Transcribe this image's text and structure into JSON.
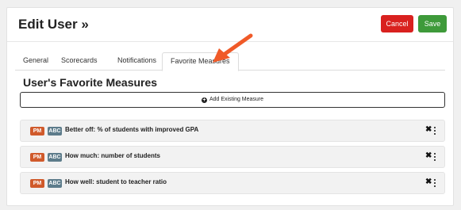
{
  "header": {
    "title": "Edit User »",
    "cancel_label": "Cancel",
    "save_label": "Save"
  },
  "tabs": [
    {
      "label": "General"
    },
    {
      "label": "Scorecards"
    },
    {
      "label": "Notifications"
    },
    {
      "label": "Favorite Measures",
      "active": true
    }
  ],
  "section": {
    "title": "User's Favorite Measures",
    "add_label": "Add Existing Measure"
  },
  "badges": {
    "pm": "PM",
    "abc": "ABC"
  },
  "measures": [
    {
      "label": "Better off: % of students with improved GPA"
    },
    {
      "label": "How much: number of students"
    },
    {
      "label": "How well: student to teacher ratio"
    }
  ],
  "icons": {
    "plus": "plus-circle-icon",
    "remove": "close-icon",
    "menu": "vertical-ellipsis-icon",
    "arrow": "annotation-arrow-icon"
  },
  "colors": {
    "cancel": "#d9211f",
    "save": "#3e9a3a",
    "pm_badge": "#d05a2b",
    "abc_badge": "#5d7c8b",
    "arrow": "#f05a28"
  }
}
